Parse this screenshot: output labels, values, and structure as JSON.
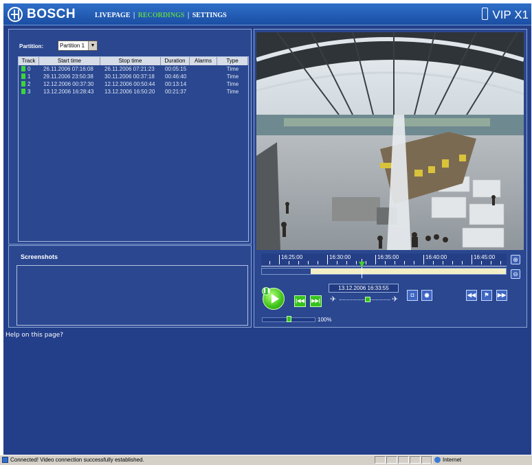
{
  "header": {
    "brand": "BOSCH",
    "nav": [
      {
        "label": "LIVEPAGE",
        "active": false
      },
      {
        "label": "RECORDINGS",
        "active": true
      },
      {
        "label": "SETTINGS",
        "active": false
      }
    ],
    "separator": "|",
    "product": "VIP X1"
  },
  "colors": {
    "accent": "#5fd24a",
    "background": "#243f8a",
    "header": "#1a4ea3"
  },
  "recordings": {
    "partition_label": "Partition:",
    "partition_value": "Partition 1",
    "columns": [
      "Track",
      "Start time",
      "Stop time",
      "Duration",
      "Alarms",
      "Type"
    ],
    "rows": [
      {
        "track": "0",
        "start": "26.11.2006 07:16:08",
        "stop": "26.11.2006 07:21:23",
        "duration": "00:05:15",
        "alarms": "",
        "type": "Time"
      },
      {
        "track": "1",
        "start": "29.11.2006 23:50:38",
        "stop": "30.11.2006 00:37:18",
        "duration": "00:46:40",
        "alarms": "",
        "type": "Time"
      },
      {
        "track": "2",
        "start": "12.12.2006 00:37:30",
        "stop": "12.12.2006 00:50:44",
        "duration": "00:13:14",
        "alarms": "",
        "type": "Time"
      },
      {
        "track": "3",
        "start": "13.12.2006 16:28:43",
        "stop": "13.12.2006 16:50:20",
        "duration": "00:21:37",
        "alarms": "",
        "type": "Time"
      }
    ]
  },
  "screenshots": {
    "title": "Screenshots"
  },
  "help_link": "Help on this page?",
  "player": {
    "time_labels": [
      "16:25:00",
      "16:30:00",
      "16:35:00",
      "16:40:00",
      "16:45:00"
    ],
    "timestamp": "13.12.2006 16:33:55",
    "volume_label": "100%",
    "playback_position_fraction": 0.41,
    "recorded_range_fraction": [
      0.2,
      1.0
    ],
    "speed_fraction": 0.55,
    "volume_fraction": 0.5,
    "icons": {
      "zoom_in": "zoom-in-icon",
      "zoom_out": "zoom-out-icon",
      "play": "play-icon",
      "pause": "pause-icon",
      "prev": "skip-back-icon",
      "next": "skip-forward-icon",
      "snapshot": "camera-icon",
      "record": "record-icon",
      "rewind": "rewind-icon",
      "bookmark": "flag-icon",
      "fast_forward": "fast-forward-icon",
      "slow": "turtle-icon",
      "fast": "hare-icon"
    }
  },
  "statusbar": {
    "message": "Connected! Video connection successfully established.",
    "zone": "Internet"
  }
}
